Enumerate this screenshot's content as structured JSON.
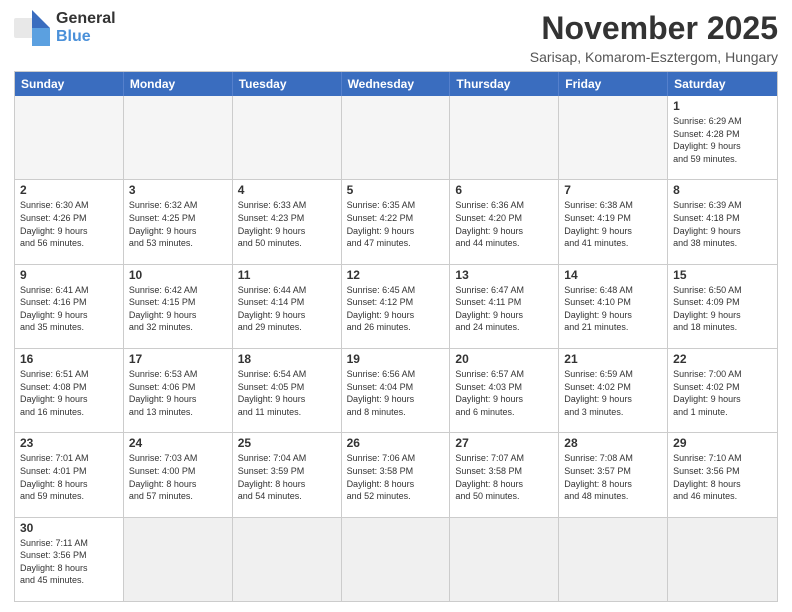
{
  "header": {
    "logo_general": "General",
    "logo_blue": "Blue",
    "month_title": "November 2025",
    "location": "Sarisap, Komarom-Esztergom, Hungary"
  },
  "days_of_week": [
    "Sunday",
    "Monday",
    "Tuesday",
    "Wednesday",
    "Thursday",
    "Friday",
    "Saturday"
  ],
  "weeks": [
    [
      {
        "day": "",
        "info": ""
      },
      {
        "day": "",
        "info": ""
      },
      {
        "day": "",
        "info": ""
      },
      {
        "day": "",
        "info": ""
      },
      {
        "day": "",
        "info": ""
      },
      {
        "day": "",
        "info": ""
      },
      {
        "day": "1",
        "info": "Sunrise: 6:29 AM\nSunset: 4:28 PM\nDaylight: 9 hours\nand 59 minutes."
      }
    ],
    [
      {
        "day": "2",
        "info": "Sunrise: 6:30 AM\nSunset: 4:26 PM\nDaylight: 9 hours\nand 56 minutes."
      },
      {
        "day": "3",
        "info": "Sunrise: 6:32 AM\nSunset: 4:25 PM\nDaylight: 9 hours\nand 53 minutes."
      },
      {
        "day": "4",
        "info": "Sunrise: 6:33 AM\nSunset: 4:23 PM\nDaylight: 9 hours\nand 50 minutes."
      },
      {
        "day": "5",
        "info": "Sunrise: 6:35 AM\nSunset: 4:22 PM\nDaylight: 9 hours\nand 47 minutes."
      },
      {
        "day": "6",
        "info": "Sunrise: 6:36 AM\nSunset: 4:20 PM\nDaylight: 9 hours\nand 44 minutes."
      },
      {
        "day": "7",
        "info": "Sunrise: 6:38 AM\nSunset: 4:19 PM\nDaylight: 9 hours\nand 41 minutes."
      },
      {
        "day": "8",
        "info": "Sunrise: 6:39 AM\nSunset: 4:18 PM\nDaylight: 9 hours\nand 38 minutes."
      }
    ],
    [
      {
        "day": "9",
        "info": "Sunrise: 6:41 AM\nSunset: 4:16 PM\nDaylight: 9 hours\nand 35 minutes."
      },
      {
        "day": "10",
        "info": "Sunrise: 6:42 AM\nSunset: 4:15 PM\nDaylight: 9 hours\nand 32 minutes."
      },
      {
        "day": "11",
        "info": "Sunrise: 6:44 AM\nSunset: 4:14 PM\nDaylight: 9 hours\nand 29 minutes."
      },
      {
        "day": "12",
        "info": "Sunrise: 6:45 AM\nSunset: 4:12 PM\nDaylight: 9 hours\nand 26 minutes."
      },
      {
        "day": "13",
        "info": "Sunrise: 6:47 AM\nSunset: 4:11 PM\nDaylight: 9 hours\nand 24 minutes."
      },
      {
        "day": "14",
        "info": "Sunrise: 6:48 AM\nSunset: 4:10 PM\nDaylight: 9 hours\nand 21 minutes."
      },
      {
        "day": "15",
        "info": "Sunrise: 6:50 AM\nSunset: 4:09 PM\nDaylight: 9 hours\nand 18 minutes."
      }
    ],
    [
      {
        "day": "16",
        "info": "Sunrise: 6:51 AM\nSunset: 4:08 PM\nDaylight: 9 hours\nand 16 minutes."
      },
      {
        "day": "17",
        "info": "Sunrise: 6:53 AM\nSunset: 4:06 PM\nDaylight: 9 hours\nand 13 minutes."
      },
      {
        "day": "18",
        "info": "Sunrise: 6:54 AM\nSunset: 4:05 PM\nDaylight: 9 hours\nand 11 minutes."
      },
      {
        "day": "19",
        "info": "Sunrise: 6:56 AM\nSunset: 4:04 PM\nDaylight: 9 hours\nand 8 minutes."
      },
      {
        "day": "20",
        "info": "Sunrise: 6:57 AM\nSunset: 4:03 PM\nDaylight: 9 hours\nand 6 minutes."
      },
      {
        "day": "21",
        "info": "Sunrise: 6:59 AM\nSunset: 4:02 PM\nDaylight: 9 hours\nand 3 minutes."
      },
      {
        "day": "22",
        "info": "Sunrise: 7:00 AM\nSunset: 4:02 PM\nDaylight: 9 hours\nand 1 minute."
      }
    ],
    [
      {
        "day": "23",
        "info": "Sunrise: 7:01 AM\nSunset: 4:01 PM\nDaylight: 8 hours\nand 59 minutes."
      },
      {
        "day": "24",
        "info": "Sunrise: 7:03 AM\nSunset: 4:00 PM\nDaylight: 8 hours\nand 57 minutes."
      },
      {
        "day": "25",
        "info": "Sunrise: 7:04 AM\nSunset: 3:59 PM\nDaylight: 8 hours\nand 54 minutes."
      },
      {
        "day": "26",
        "info": "Sunrise: 7:06 AM\nSunset: 3:58 PM\nDaylight: 8 hours\nand 52 minutes."
      },
      {
        "day": "27",
        "info": "Sunrise: 7:07 AM\nSunset: 3:58 PM\nDaylight: 8 hours\nand 50 minutes."
      },
      {
        "day": "28",
        "info": "Sunrise: 7:08 AM\nSunset: 3:57 PM\nDaylight: 8 hours\nand 48 minutes."
      },
      {
        "day": "29",
        "info": "Sunrise: 7:10 AM\nSunset: 3:56 PM\nDaylight: 8 hours\nand 46 minutes."
      }
    ],
    [
      {
        "day": "30",
        "info": "Sunrise: 7:11 AM\nSunset: 3:56 PM\nDaylight: 8 hours\nand 45 minutes."
      },
      {
        "day": "",
        "info": ""
      },
      {
        "day": "",
        "info": ""
      },
      {
        "day": "",
        "info": ""
      },
      {
        "day": "",
        "info": ""
      },
      {
        "day": "",
        "info": ""
      },
      {
        "day": "",
        "info": ""
      }
    ]
  ]
}
